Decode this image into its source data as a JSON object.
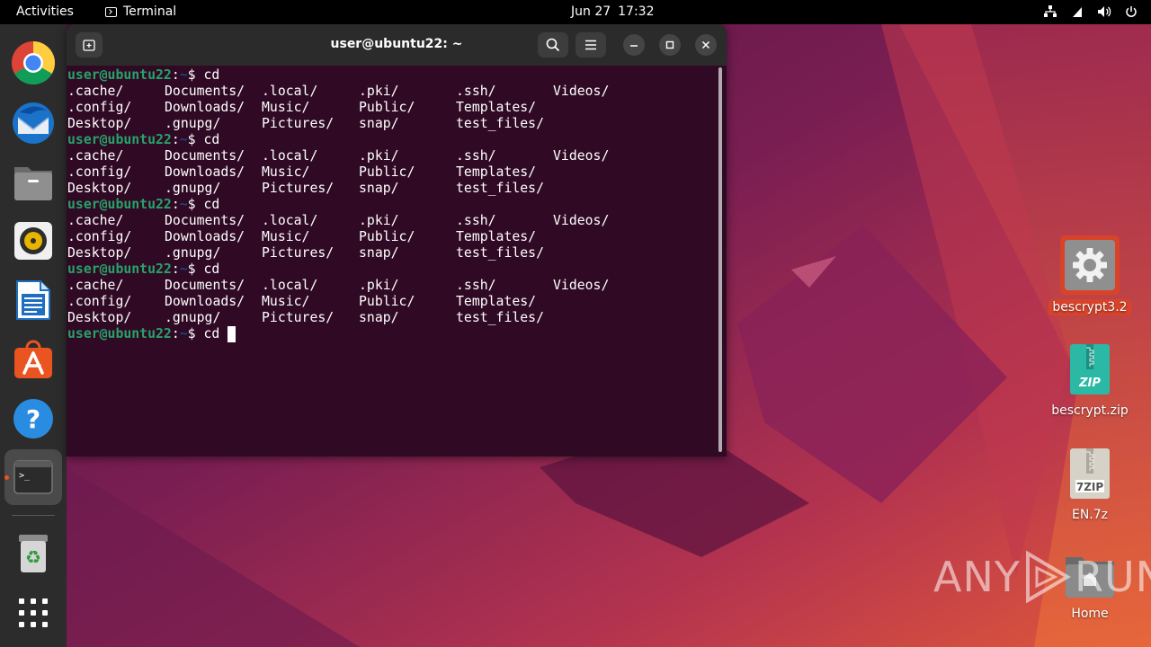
{
  "topbar": {
    "activities": "Activities",
    "app_name": "Terminal",
    "date": "Jun 27",
    "time": "17:32",
    "tray_icons": [
      "network-icon",
      "accessibility-icon",
      "volume-icon",
      "power-icon"
    ]
  },
  "dock": {
    "items": [
      {
        "name": "chrome-icon"
      },
      {
        "name": "thunderbird-icon"
      },
      {
        "name": "files-icon"
      },
      {
        "name": "rhythmbox-icon"
      },
      {
        "name": "writer-icon"
      },
      {
        "name": "app-center-icon"
      },
      {
        "name": "help-icon"
      },
      {
        "name": "terminal-icon",
        "running": true,
        "active": true
      },
      {
        "name": "trash-icon"
      },
      {
        "name": "show-apps-icon"
      }
    ]
  },
  "terminal": {
    "title": "user@ubuntu22: ~",
    "prompt_user": "user@ubuntu22",
    "prompt_sep": ":",
    "prompt_path": "~",
    "prompt_end": "$ cd",
    "listing_rows": [
      [
        ".cache/",
        "Documents/",
        ".local/",
        ".pki/",
        ".ssh/",
        "Videos/"
      ],
      [
        ".config/",
        "Downloads/",
        "Music/",
        "Public/",
        "Templates/"
      ],
      [
        "Desktop/",
        ".gnupg/",
        "Pictures/",
        "snap/",
        "test_files/"
      ]
    ],
    "last_command": "$ cd "
  },
  "desktop": {
    "icons": [
      {
        "label": "bescrypt3.2",
        "icon": "settings-gear-icon",
        "selected": true
      },
      {
        "label": "bescrypt.zip",
        "icon": "zip-archive-icon"
      },
      {
        "label": "EN.7z",
        "icon": "7z-archive-icon"
      },
      {
        "label": "Home",
        "icon": "home-folder-icon"
      }
    ]
  },
  "watermark": {
    "text_left": "ANY",
    "text_right": "RUN"
  },
  "colors": {
    "topbar": "#000000",
    "dock": "#2c2c2c",
    "terminal_bg": "#300a24",
    "prompt_user": "#26a269",
    "prompt_path": "#12488b",
    "accent": "#e95420"
  }
}
